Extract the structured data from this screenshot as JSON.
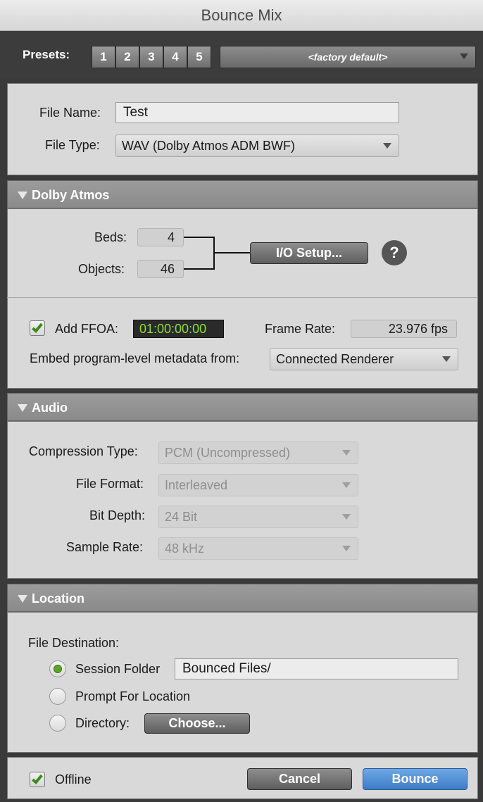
{
  "window": {
    "title": "Bounce Mix"
  },
  "presets": {
    "label": "Presets:",
    "buttons": [
      "1",
      "2",
      "3",
      "4",
      "5"
    ],
    "selected": "<factory default>"
  },
  "file": {
    "name_label": "File Name:",
    "name_value": "Test",
    "type_label": "File Type:",
    "type_value": "WAV (Dolby Atmos ADM BWF)"
  },
  "dolby": {
    "header": "Dolby Atmos",
    "beds_label": "Beds:",
    "beds_value": "4",
    "objects_label": "Objects:",
    "objects_value": "46",
    "io_setup_label": "I/O Setup...",
    "help_glyph": "?",
    "add_ffoa_label": "Add FFOA:",
    "add_ffoa_checked": true,
    "ffoa_value": "01:00:00:00",
    "frame_rate_label": "Frame Rate:",
    "frame_rate_value": "23.976 fps",
    "embed_label": "Embed program-level metadata from:",
    "embed_value": "Connected Renderer"
  },
  "audio": {
    "header": "Audio",
    "compression_label": "Compression Type:",
    "compression_value": "PCM (Uncompressed)",
    "format_label": "File Format:",
    "format_value": "Interleaved",
    "bit_depth_label": "Bit Depth:",
    "bit_depth_value": "24 Bit",
    "sample_rate_label": "Sample Rate:",
    "sample_rate_value": "48 kHz"
  },
  "location": {
    "header": "Location",
    "destination_label": "File Destination:",
    "session_folder_label": "Session Folder",
    "session_folder_value": "Bounced Files/",
    "prompt_label": "Prompt For Location",
    "directory_label": "Directory:",
    "choose_label": "Choose...",
    "selected": "session_folder"
  },
  "footer": {
    "offline_label": "Offline",
    "offline_checked": true,
    "cancel_label": "Cancel",
    "bounce_label": "Bounce"
  },
  "colors": {
    "accent_blue": "#4a8ad6",
    "ffoa_green": "#8ede3a",
    "radio_green": "#5aa42a",
    "header_gray": "#929292"
  }
}
